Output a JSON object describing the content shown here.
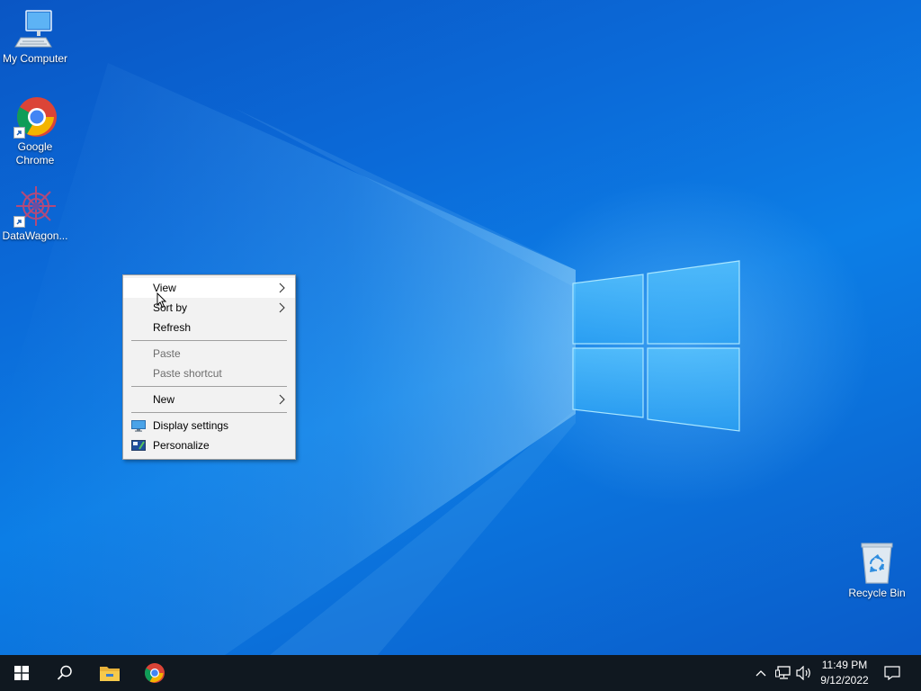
{
  "desktop": {
    "icons": [
      {
        "label": "My Computer",
        "icon": "computer-icon"
      },
      {
        "label": "Google Chrome",
        "icon": "chrome-icon"
      },
      {
        "label": "DataWagon...",
        "icon": "datawagon-icon"
      },
      {
        "label": "Recycle Bin",
        "icon": "recycle-bin-icon"
      }
    ]
  },
  "context_menu": {
    "items": {
      "view": "View",
      "sort_by": "Sort by",
      "refresh": "Refresh",
      "paste": "Paste",
      "paste_shortcut": "Paste shortcut",
      "new": "New",
      "display_settings": "Display settings",
      "personalize": "Personalize"
    }
  },
  "taskbar": {
    "pinned": [
      "start-icon",
      "search-icon",
      "file-explorer-icon",
      "chrome-icon"
    ],
    "tray": [
      "chevron-up-icon",
      "network-icon",
      "volume-icon",
      "notification-icon"
    ],
    "clock": {
      "time": "11:49 PM",
      "date": "9/12/2022"
    }
  },
  "colors": {
    "wallpaper": "#0b6ad8",
    "taskbar": "#101820",
    "menu_bg": "#f2f2f2",
    "menu_disabled_text": "#6d6d6d"
  }
}
